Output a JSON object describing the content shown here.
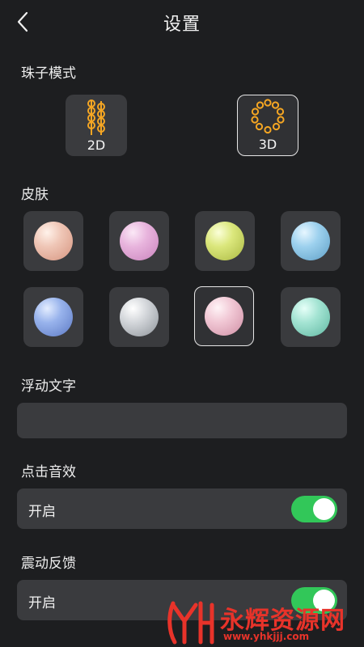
{
  "header": {
    "title": "设置"
  },
  "bead_mode": {
    "label": "珠子模式",
    "options": [
      {
        "label": "2D",
        "icon": "bead-strand-icon",
        "selected": false
      },
      {
        "label": "3D",
        "icon": "bead-ring-icon",
        "selected": true
      }
    ]
  },
  "skin": {
    "label": "皮肤",
    "options": [
      {
        "name": "peach",
        "color": "#e8b3a0",
        "selected": false
      },
      {
        "name": "pink",
        "color": "#e3a4d6",
        "selected": false
      },
      {
        "name": "lime",
        "color": "#d2e06a",
        "selected": false
      },
      {
        "name": "sky",
        "color": "#8cc6e6",
        "selected": false
      },
      {
        "name": "blue",
        "color": "#84a4e6",
        "selected": false
      },
      {
        "name": "silver",
        "color": "#c7cbd0",
        "selected": false
      },
      {
        "name": "rose",
        "color": "#eebfce",
        "selected": true
      },
      {
        "name": "mint",
        "color": "#94dcca",
        "selected": false
      }
    ]
  },
  "floating_text": {
    "label": "浮动文字",
    "value": ""
  },
  "click_sound": {
    "label": "点击音效",
    "row_label": "开启",
    "enabled": true
  },
  "vibration": {
    "label": "震动反馈",
    "row_label": "开启",
    "enabled": true
  },
  "watermark": {
    "text": "永辉资源网",
    "url": "www.yhkjjj.com"
  },
  "colors": {
    "background": "#1d1e20",
    "tile": "#3a3b3e",
    "accent_orange": "#f5a623",
    "toggle_on": "#32c759"
  }
}
